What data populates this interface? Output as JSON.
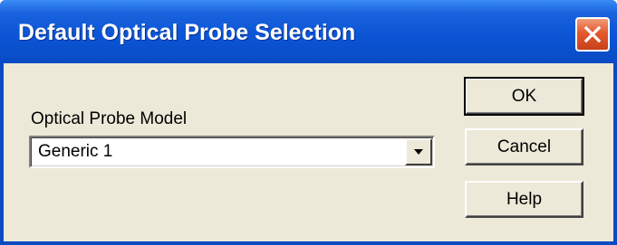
{
  "window": {
    "title": "Default Optical Probe Selection"
  },
  "form": {
    "model_label": "Optical Probe Model",
    "model_value": "Generic 1"
  },
  "buttons": {
    "ok": "OK",
    "cancel": "Cancel",
    "help": "Help"
  },
  "icons": {
    "close": "close-icon",
    "dropdown": "chevron-down-icon"
  },
  "colors": {
    "titlebar": "#0a4bc4",
    "close_button": "#e45a2e",
    "dialog_background": "#ece9d8"
  }
}
